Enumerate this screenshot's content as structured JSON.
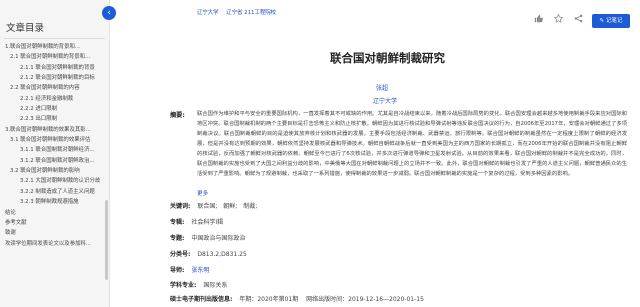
{
  "sidebar": {
    "title": "文章目录",
    "items": [
      {
        "label": "1.联合国对朝鲜制裁的背景和...",
        "level": 1
      },
      {
        "label": "2.1 联合国对朝鲜制裁的背景和...",
        "level": 2
      },
      {
        "label": "2.1.1 联合国对朝鲜制裁的背景",
        "level": 3
      },
      {
        "label": "2.1.2 联合国对朝鲜制裁的目标",
        "level": 3
      },
      {
        "label": "2.2 联合国对朝鲜制裁的内容",
        "level": 2
      },
      {
        "label": "2.2.1 经济和金融制裁",
        "level": 3
      },
      {
        "label": "2.2.2 进口限制",
        "level": 3
      },
      {
        "label": "2.2.3 出口限制",
        "level": 3
      },
      {
        "label": "3.联合国对朝鲜制裁的效果及其影...",
        "level": 1
      },
      {
        "label": "3.1 联合国对朝鲜制裁的效果评估",
        "level": 2
      },
      {
        "label": "3.1.1 联合国制裁对朝鲜经济...",
        "level": 3
      },
      {
        "label": "3.1.2 联合国制裁对朝鲜政治...",
        "level": 3
      },
      {
        "label": "3.2 联合国对朝鲜制裁的影响",
        "level": 2
      },
      {
        "label": "3.2.1 大国对朝鲜制裁的认识分歧",
        "level": 3
      },
      {
        "label": "3.2.2 制裁造成了人道主义问题",
        "level": 3
      },
      {
        "label": "3.2.3 朝鲜制裁规避措施",
        "level": 3
      },
      {
        "label": "结论",
        "level": 1
      },
      {
        "label": "参考文献",
        "level": 1
      },
      {
        "label": "致谢",
        "level": 1
      },
      {
        "label": "攻读学位期间发表论文以及参加科...",
        "level": 1
      }
    ]
  },
  "header": {
    "tags": [
      "辽宁大学",
      "辽宁省 211工程院校"
    ],
    "record_button": "记笔记"
  },
  "icons": {
    "collapse": "chevron-left-icon",
    "tools": [
      "thumbs-up-icon",
      "star-icon",
      "share-icon",
      "download-icon"
    ]
  },
  "colors": {
    "accent": "#1e5bd8",
    "link": "#1d4fc9"
  },
  "paper": {
    "title": "联合国对朝鲜制裁研究",
    "author": "张超",
    "institution": "辽宁大学",
    "abstract_label": "摘要:",
    "abstract": "联合国作为维护和平与安全的重要国际机构，一直发挥着其不可或缺的作用。尤其是自冷战结束以来，随着冷战后国际局势的变化，联合国安理会越来越多地使用制裁手段来应对国际和地区冲突。联合国制裁机制的两个主要目标是打击恐怖主义和防止核扩散。朝鲜因为其进行核试验和导弹试射等违反联合国决议的行为，自2006年至2017年，安理会对朝鲜通过了多项制裁决议。联合国制裁朝鲜的目的是迫使其放弃核计划和核武器的发展，主要手段包括经济制裁、武器禁运、旅行限制等。联合国对朝鲜的制裁虽然在一定程度上限制了朝鲜的经济发展，但是并没有达到预期的效果，朝鲜依然坚持发展核武器和导弹技术。朝鲜自朝鲜战争后就一直受到美国为主的西方国家的长期孤立，而在2006年开始的联合国制裁并没有阻止朝鲜的核试验，反而加强了朝鲜对核武器的依赖。朝鲜至今已进行了6次核试验，并多次进行弹道导弹和卫星发射试验。从目前的效果来看，联合国对朝鲜的制裁并不是完全成功的。同时，联合国制裁的实施也受到了大国之间利益分歧的影响，中美俄等大国在对朝鲜制裁问题上的立场并不一致。此外，联合国对朝鲜的制裁也引发了严重的人道主义问题，朝鲜普通民众的生活受到了严重影响。朝鲜为了规避制裁，也采取了一系列措施，使得制裁的效果进一步减弱。联合国对朝鲜制裁的实施是一个复杂的过程，受到多种因素的影响。",
    "more_link": "更多",
    "keywords_label": "关键词:",
    "keywords": [
      "联合国;",
      "朝鲜;",
      "制裁;"
    ],
    "major_label": "专辑:",
    "major": "社会科学Ⅰ辑",
    "subject_label": "专题:",
    "subject": "中国政治与国际政治",
    "classification_label": "分类号:",
    "classification": "D813.2;D831.25",
    "advisor_label": "导师:",
    "advisor": "张东明",
    "discipline_label": "学科专业:",
    "discipline": "国际关系",
    "publication_label": "硕士电子期刊出版信息:",
    "publication_year": "年期：2020年第01期",
    "publication_date": "网络出版时间：2019-12-16—2020-01-15"
  }
}
